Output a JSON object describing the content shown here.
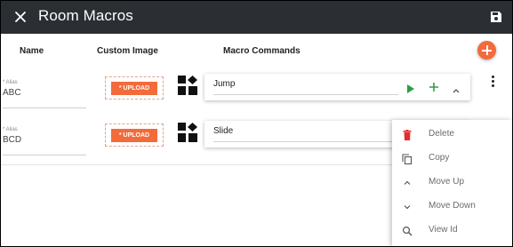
{
  "header": {
    "title": "Room Macros",
    "close_icon": "close-icon",
    "save_icon": "save-floppy-icon"
  },
  "columns": {
    "name": "Name",
    "custom_image": "Custom Image",
    "macro_commands": "Macro Commands"
  },
  "rows": [
    {
      "alias_label": "* Alias",
      "alias_value": "ABC",
      "upload_label": "* UPLOAD",
      "macro_value": "Jump"
    },
    {
      "alias_label": "* Alias",
      "alias_value": "BCD",
      "upload_label": "* UPLOAD",
      "macro_value": "Slide"
    }
  ],
  "context_menu": {
    "items": [
      {
        "label": "Delete",
        "icon": "trash-icon"
      },
      {
        "label": "Copy",
        "icon": "copy-icon"
      },
      {
        "label": "Move Up",
        "icon": "chevron-up-icon"
      },
      {
        "label": "Move Down",
        "icon": "chevron-down-icon"
      },
      {
        "label": "View Id",
        "icon": "search-icon"
      }
    ]
  },
  "colors": {
    "header_bg": "#2b2f34",
    "accent": "#f36b3b",
    "play_green": "#2e9e44",
    "delete_red": "#e52b2b"
  }
}
